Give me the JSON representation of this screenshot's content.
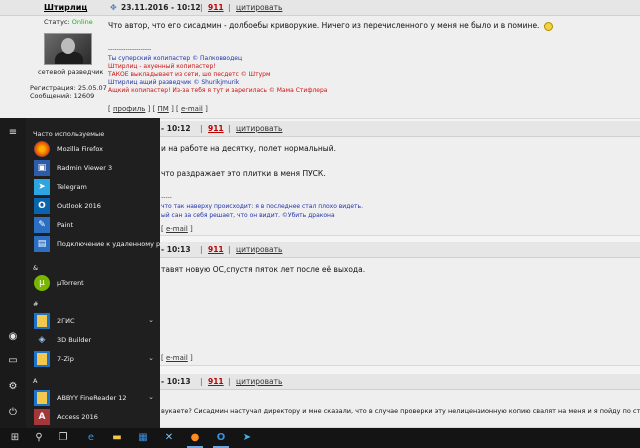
{
  "forum": {
    "post1": {
      "author": "Штирлиц",
      "date": "23.11.2016 - 10:12",
      "status_label": "Статус:",
      "status_value": "Online",
      "rank": "сетевой разведчик",
      "registration": "Регистрация: 25.05.07",
      "messages": "Сообщений: 12609",
      "text": "Что автор, что его сисадмин - долбоебы криворукие. Ничего из перечисленного у меня не было и в помине.",
      "sig_dashes": "--------------------",
      "sig": [
        "Ты суперский копипастер © Палковводец",
        "Штирлиц - ахуенный копипастер!",
        "ТАКОЕ выкладывает из сети, шо песдетс © Штурм",
        "Штирлиц ащий разведчик © Shurikjmurik",
        "Ащкий копипастер! Из-за тебя я тут и зарегилась © Мама Стифлера"
      ],
      "actions": [
        "профиль",
        "ПМ",
        "e-mail"
      ]
    },
    "post2": {
      "date": "- 10:12",
      "num": "911",
      "quote": "цитировать",
      "text1": "и на работе на десятку, полет нормальный.",
      "text2": "что раздражает это плитки в меня ПУСК.",
      "sig_dashes": "-----",
      "sig1": "что так наверху происходит: я в последнее стал плохо видеть.",
      "sig2": "ый сан за себя решает, что он видит. ©Убить дракона",
      "actions": [
        "e-mail"
      ]
    },
    "post3": {
      "date": "- 10:13",
      "num": "911",
      "quote": "цитировать",
      "text": "тавят новую ОС,спустя пяток лет после её выхода.",
      "actions": [
        "e-mail"
      ]
    },
    "post4": {
      "date": "- 10:13",
      "num": "911",
      "quote": "цитировать",
      "text": "вукаете? Сисадмин настучал директору и мне сказали, что в случае проверки эту нелицензионную копию свалят на меня и я пойду по ст"
    },
    "post1_head": {
      "num": "911",
      "quote": "цитировать"
    }
  },
  "start_menu": {
    "section_frequent": "Часто используемые",
    "frequent": [
      {
        "label": "Mozilla Firefox",
        "icon": "firefox-icon",
        "color": "#e66000"
      },
      {
        "label": "Radmin Viewer 3",
        "icon": "radmin-icon",
        "color": "#2d5ca8"
      },
      {
        "label": "Telegram",
        "icon": "telegram-icon",
        "color": "#2ca5e0"
      },
      {
        "label": "Outlook 2016",
        "icon": "outlook-icon",
        "color": "#0a64ad"
      },
      {
        "label": "Paint",
        "icon": "paint-icon",
        "color": "#2b6fc2"
      },
      {
        "label": "Подключение к удаленному раб...",
        "icon": "remote-desktop-icon",
        "color": "#2b6fc2"
      }
    ],
    "section_amp": "&",
    "amp_items": [
      {
        "label": "µTorrent",
        "icon": "utorrent-icon",
        "color": "#79b600"
      }
    ],
    "section_hash": "#",
    "hash_items": [
      {
        "label": "2ГИС",
        "icon": "folder-icon",
        "color": "#1e73c8",
        "chevron": true
      },
      {
        "label": "3D Builder",
        "icon": "3d-builder-icon",
        "color": "#1e73c8",
        "chevron": false
      },
      {
        "label": "7-Zip",
        "icon": "folder-icon",
        "color": "#1e73c8",
        "chevron": true
      }
    ],
    "section_a": "A",
    "a_items": [
      {
        "label": "ABBYY FineReader 12",
        "icon": "folder-icon",
        "color": "#1e73c8",
        "chevron": true
      },
      {
        "label": "Access 2016",
        "icon": "access-icon",
        "color": "#a4373a",
        "chevron": false
      }
    ]
  },
  "taskbar": {
    "items": [
      "start-icon",
      "search-icon",
      "task-view-icon",
      "edge-icon",
      "file-explorer-icon",
      "store-icon",
      "network-icon",
      "firefox-icon",
      "outlook-icon",
      "telegram-icon"
    ]
  }
}
